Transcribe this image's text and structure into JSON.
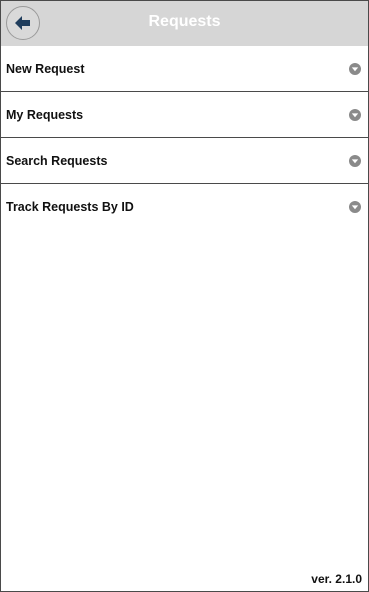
{
  "header": {
    "title": "Requests",
    "back_icon": "back-arrow-icon"
  },
  "menu": {
    "items": [
      {
        "label": "New Request",
        "icon": "chevron-down-icon"
      },
      {
        "label": "My Requests",
        "icon": "chevron-down-icon"
      },
      {
        "label": "Search Requests",
        "icon": "chevron-down-icon"
      },
      {
        "label": "Track Requests By ID",
        "icon": "chevron-down-icon"
      }
    ]
  },
  "footer": {
    "version": "ver. 2.1.0"
  },
  "colors": {
    "header_bg": "#d6d6d6",
    "title_text": "#ffffff",
    "back_arrow": "#1f3d5c",
    "chevron_bg": "#8a8a8a"
  }
}
